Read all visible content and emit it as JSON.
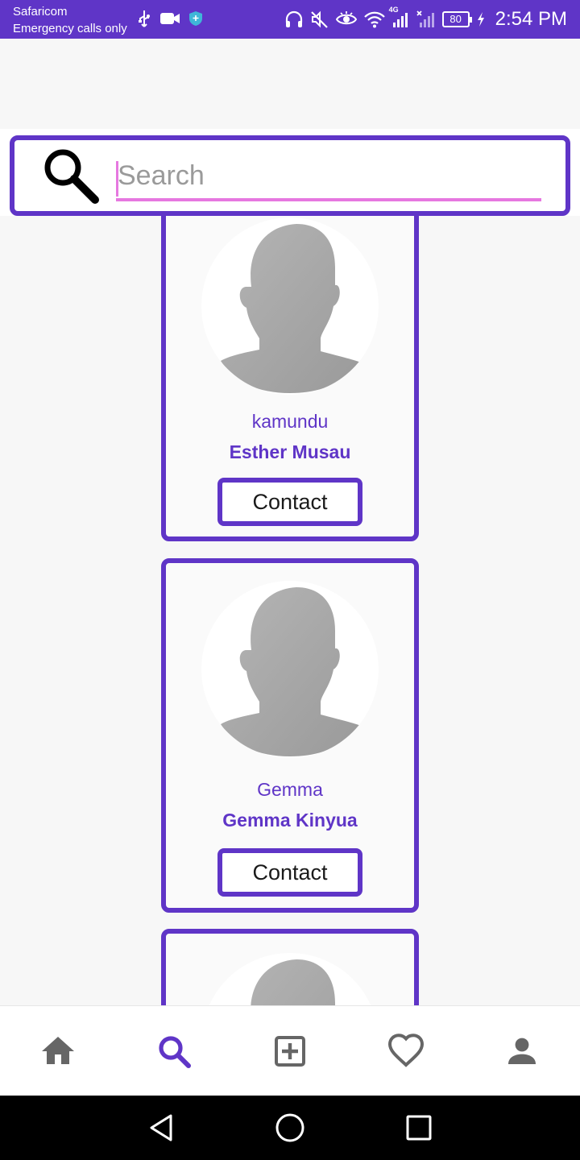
{
  "status_bar": {
    "carrier": "Safaricom",
    "emergency": "Emergency calls only",
    "battery": "80",
    "network": "4G",
    "time": "2:54 PM",
    "left_icons": [
      "usb-icon",
      "video-icon",
      "shield-icon"
    ],
    "right_icons": [
      "headphones-icon",
      "mute-icon",
      "eye-icon",
      "wifi-icon",
      "signal-icon",
      "no-signal-icon",
      "battery-icon",
      "charging-icon"
    ]
  },
  "search": {
    "placeholder": "Search",
    "value": ""
  },
  "profiles": [
    {
      "username": "kamundu",
      "name": "Esther Musau",
      "button": "Contact"
    },
    {
      "username": "Gemma",
      "name": "Gemma Kinyua",
      "button": "Contact"
    },
    {
      "username": "",
      "name": "",
      "button": ""
    }
  ],
  "bottom_nav": {
    "items": [
      {
        "icon": "home-icon",
        "active": false
      },
      {
        "icon": "search-icon",
        "active": true
      },
      {
        "icon": "add-box-icon",
        "active": false
      },
      {
        "icon": "heart-icon",
        "active": false
      },
      {
        "icon": "person-icon",
        "active": false
      }
    ]
  },
  "system_nav": [
    "back-icon",
    "home-circle-icon",
    "recents-icon"
  ],
  "colors": {
    "accent": "#5f35c7",
    "search_underline": "#e678e0",
    "nav_inactive": "#666666",
    "background": "#f7f7f7"
  }
}
